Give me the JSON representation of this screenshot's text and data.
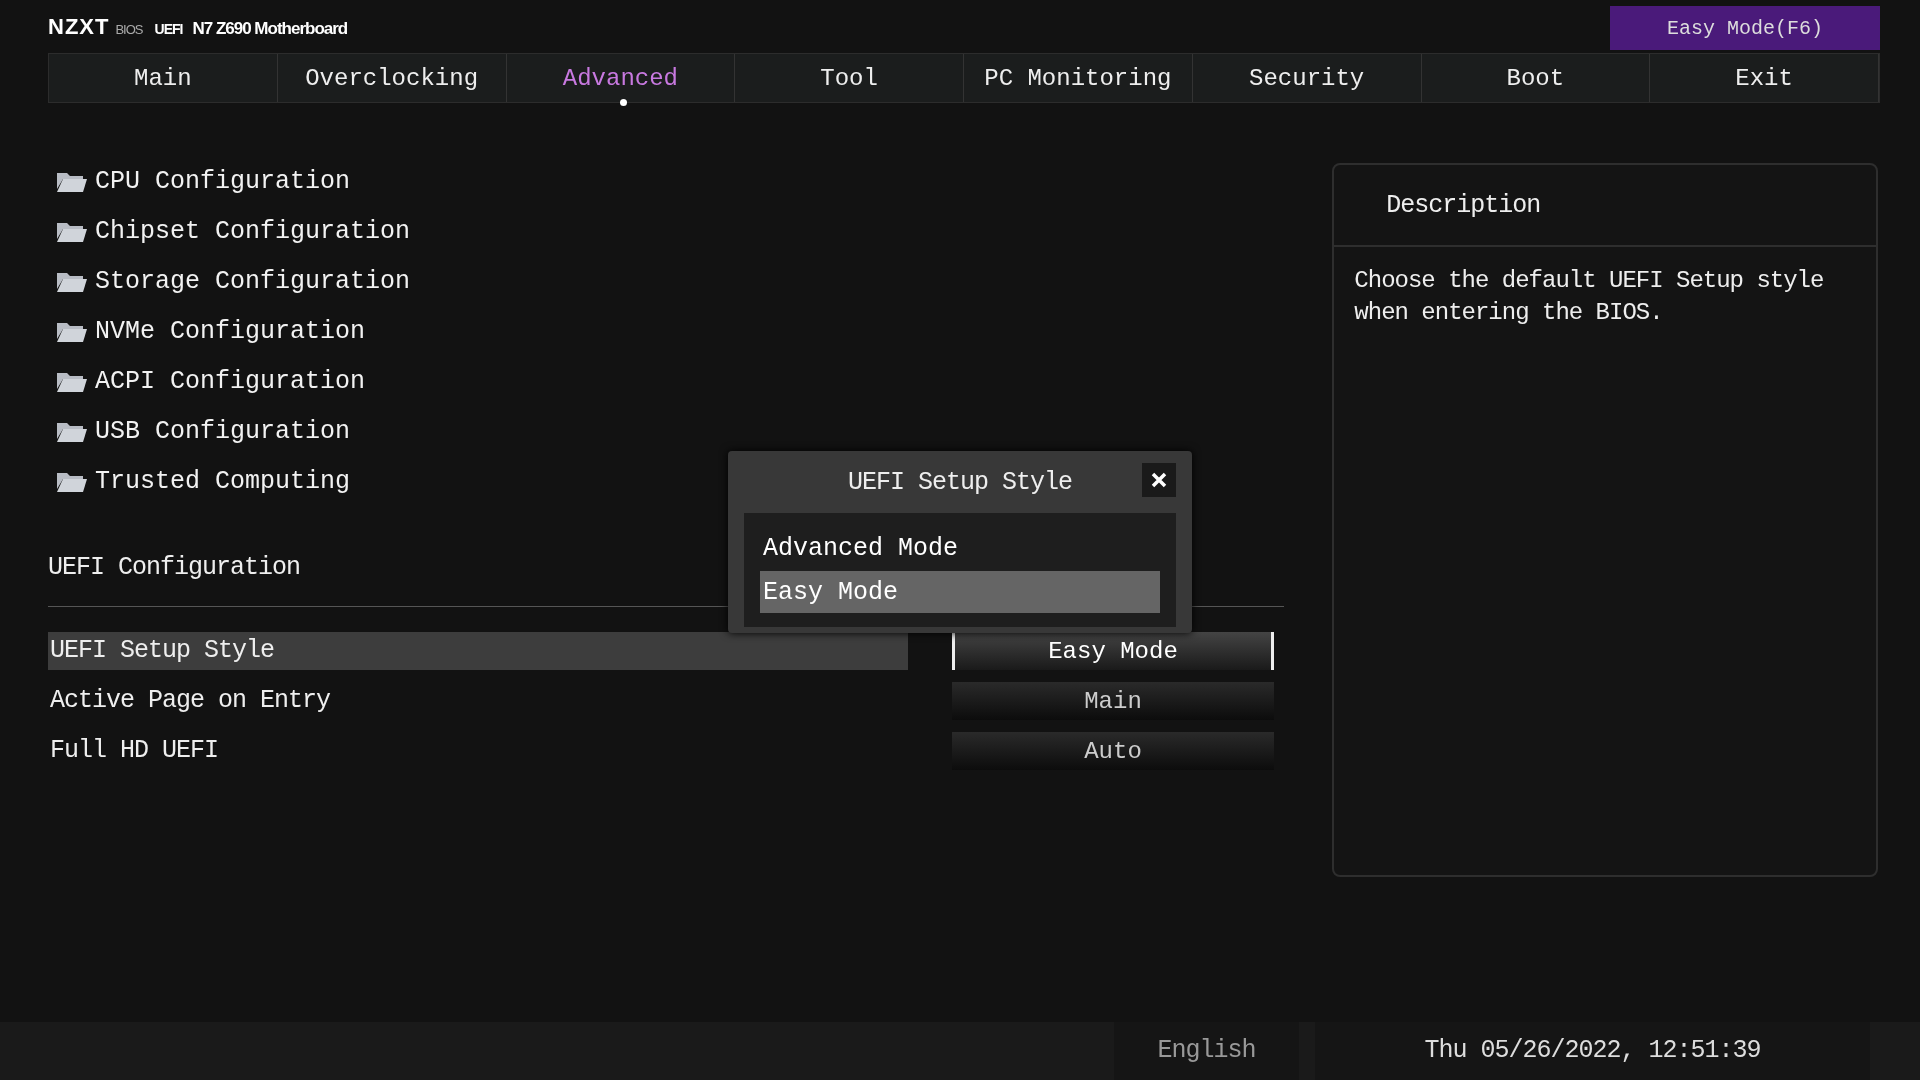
{
  "header": {
    "brand": "NZXT",
    "brand_sub": "BIOS",
    "uefi": "UEFI",
    "model": "N7 Z690 Motherboard",
    "mode_button": "Easy Mode(F6)"
  },
  "tabs": [
    {
      "label": "Main",
      "selected": false
    },
    {
      "label": "Overclocking",
      "selected": false
    },
    {
      "label": "Advanced",
      "selected": true
    },
    {
      "label": "Tool",
      "selected": false
    },
    {
      "label": "PC Monitoring",
      "selected": false
    },
    {
      "label": "Security",
      "selected": false
    },
    {
      "label": "Boot",
      "selected": false
    },
    {
      "label": "Exit",
      "selected": false
    }
  ],
  "menu_items": [
    "CPU Configuration",
    "Chipset Configuration",
    "Storage Configuration",
    "NVMe Configuration",
    "ACPI Configuration",
    "USB Configuration",
    "Trusted Computing"
  ],
  "section_title": "UEFI Configuration",
  "settings": [
    {
      "label": "UEFI Setup Style",
      "value": "Easy Mode",
      "selected": true
    },
    {
      "label": "Active Page on Entry",
      "value": "Main",
      "selected": false
    },
    {
      "label": "Full HD UEFI",
      "value": "Auto",
      "selected": false
    }
  ],
  "description": {
    "title": "Description",
    "text": "Choose the default UEFI Setup style when entering the BIOS."
  },
  "popup": {
    "title": "UEFI Setup Style",
    "options": [
      {
        "label": "Advanced Mode",
        "selected": false
      },
      {
        "label": "Easy Mode",
        "selected": true
      }
    ]
  },
  "status_bar": {
    "language": "English",
    "datetime": "Thu 05/26/2022, 12:51:39"
  }
}
